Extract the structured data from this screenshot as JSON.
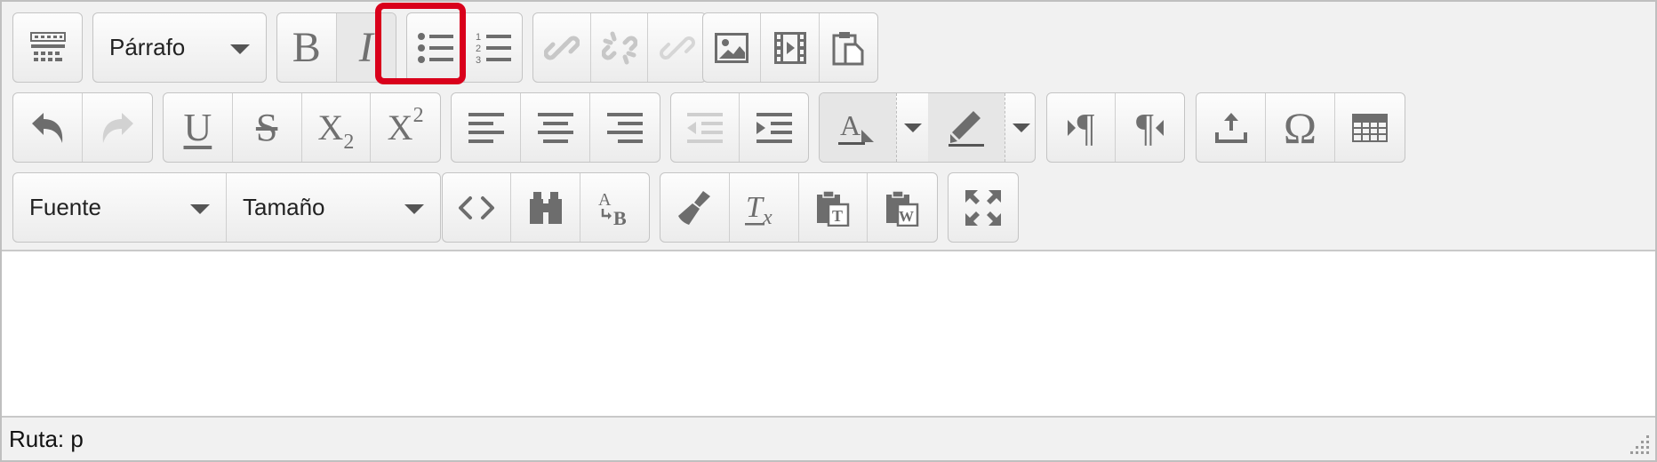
{
  "toolbar": {
    "paragraph_format": "Párrafo",
    "font": "Fuente",
    "size": "Tamaño"
  },
  "icons": {
    "toolbar_toggle": "toolbar-toggle-icon",
    "bold": "B",
    "italic": "I",
    "underline": "U",
    "strike": "S",
    "subscript": "X",
    "subscript_sub": "2",
    "superscript": "X",
    "superscript_sup": "2",
    "omega": "Ω",
    "ltr": "¶",
    "rtl": "¶"
  },
  "active_button": "italic",
  "highlight_color": "#d9001b",
  "status": {
    "path": "Ruta: p"
  }
}
